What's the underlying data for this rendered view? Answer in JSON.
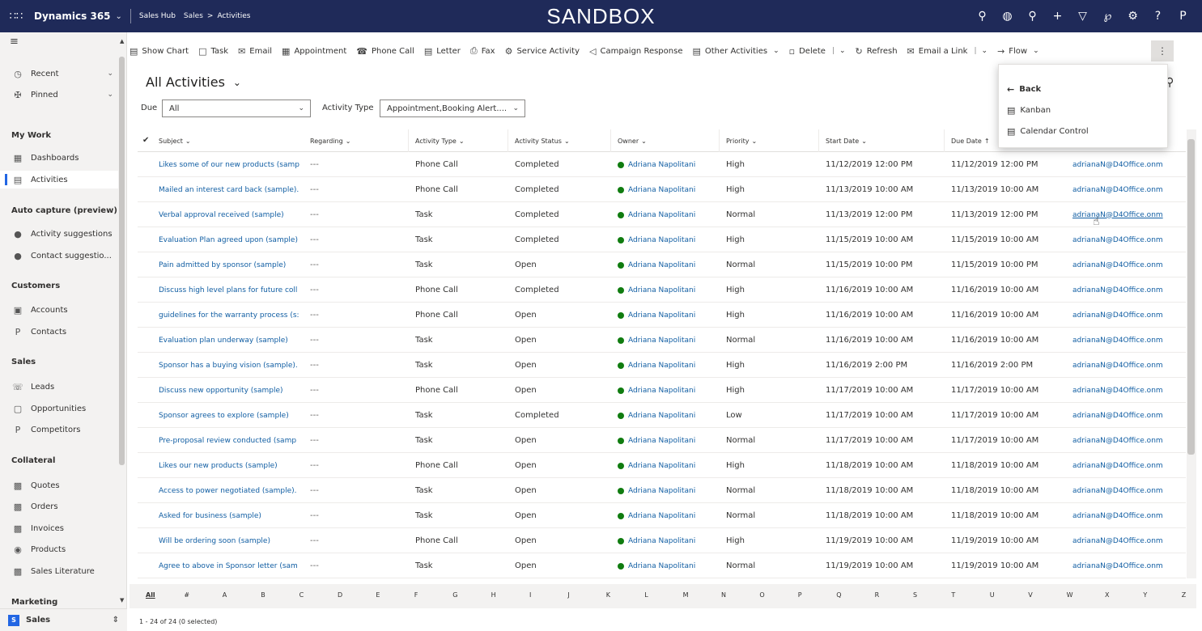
{
  "topbar": {
    "app_name": "Dynamics 365",
    "hub": "Sales Hub",
    "breadcrumb": [
      "Sales",
      "Activities"
    ],
    "environment": "SANDBOX",
    "icons": [
      "search-icon",
      "lightbulb-icon",
      "task-icon",
      "plus-icon",
      "filter-icon",
      "assistant-icon",
      "gear-icon",
      "help-icon",
      "user-icon"
    ]
  },
  "sidebar": {
    "recent": "Recent",
    "pinned": "Pinned",
    "sections": {
      "my_work": "My Work",
      "auto_capture": "Auto capture (preview)",
      "customers": "Customers",
      "sales": "Sales",
      "collateral": "Collateral",
      "marketing": "Marketing"
    },
    "items": {
      "dashboards": "Dashboards",
      "activities": "Activities",
      "activity_suggestions": "Activity suggestions",
      "contact_suggestions": "Contact suggestio...",
      "accounts": "Accounts",
      "contacts": "Contacts",
      "leads": "Leads",
      "opportunities": "Opportunities",
      "competitors": "Competitors",
      "quotes": "Quotes",
      "orders": "Orders",
      "invoices": "Invoices",
      "products": "Products",
      "sales_literature": "Sales Literature"
    },
    "area_badge": "S",
    "area": "Sales"
  },
  "commandbar": {
    "show_chart": "Show Chart",
    "task": "Task",
    "email": "Email",
    "appointment": "Appointment",
    "phone_call": "Phone Call",
    "letter": "Letter",
    "fax": "Fax",
    "service_activity": "Service Activity",
    "campaign_response": "Campaign Response",
    "other_activities": "Other Activities",
    "delete": "Delete",
    "refresh": "Refresh",
    "email_link": "Email a Link",
    "flow": "Flow"
  },
  "view": {
    "title": "All Activities",
    "due_label": "Due",
    "due_value": "All",
    "activity_type_label": "Activity Type",
    "activity_type_value": "Appointment,Booking Alert...."
  },
  "grid": {
    "headers": {
      "subject": "Subject",
      "regarding": "Regarding",
      "activity_type": "Activity Type",
      "activity_status": "Activity Status",
      "owner": "Owner",
      "priority": "Priority",
      "start_date": "Start Date",
      "due_date": "Due Date"
    },
    "rows": [
      {
        "subject": "Likes some of our new products (samp",
        "regarding": "---",
        "type": "Phone Call",
        "status": "Completed",
        "owner": "Adriana Napolitani",
        "priority": "High",
        "start": "11/12/2019 12:00 PM",
        "due": "11/12/2019 12:00 PM",
        "email": "adrianaN@D4Office.onm"
      },
      {
        "subject": "Mailed an interest card back (sample).",
        "regarding": "---",
        "type": "Phone Call",
        "status": "Completed",
        "owner": "Adriana Napolitani",
        "priority": "High",
        "start": "11/13/2019 10:00 AM",
        "due": "11/13/2019 10:00 AM",
        "email": "adrianaN@D4Office.onm"
      },
      {
        "subject": "Verbal approval received (sample)",
        "regarding": "---",
        "type": "Task",
        "status": "Completed",
        "owner": "Adriana Napolitani",
        "priority": "Normal",
        "start": "11/13/2019 12:00 PM",
        "due": "11/13/2019 12:00 PM",
        "email": "adrianaN@D4Office.onm"
      },
      {
        "subject": "Evaluation Plan agreed upon (sample)",
        "regarding": "---",
        "type": "Task",
        "status": "Completed",
        "owner": "Adriana Napolitani",
        "priority": "High",
        "start": "11/15/2019 10:00 AM",
        "due": "11/15/2019 10:00 AM",
        "email": "adrianaN@D4Office.onm"
      },
      {
        "subject": "Pain admitted by sponsor (sample)",
        "regarding": "---",
        "type": "Task",
        "status": "Open",
        "owner": "Adriana Napolitani",
        "priority": "Normal",
        "start": "11/15/2019 10:00 PM",
        "due": "11/15/2019 10:00 PM",
        "email": "adrianaN@D4Office.onm"
      },
      {
        "subject": "Discuss high level plans for future coll",
        "regarding": "---",
        "type": "Phone Call",
        "status": "Completed",
        "owner": "Adriana Napolitani",
        "priority": "High",
        "start": "11/16/2019 10:00 AM",
        "due": "11/16/2019 10:00 AM",
        "email": "adrianaN@D4Office.onm"
      },
      {
        "subject": "guidelines for the warranty process (s:",
        "regarding": "---",
        "type": "Phone Call",
        "status": "Open",
        "owner": "Adriana Napolitani",
        "priority": "High",
        "start": "11/16/2019 10:00 AM",
        "due": "11/16/2019 10:00 AM",
        "email": "adrianaN@D4Office.onm"
      },
      {
        "subject": "Evaluation plan underway (sample)",
        "regarding": "---",
        "type": "Task",
        "status": "Open",
        "owner": "Adriana Napolitani",
        "priority": "Normal",
        "start": "11/16/2019 10:00 AM",
        "due": "11/16/2019 10:00 AM",
        "email": "adrianaN@D4Office.onm"
      },
      {
        "subject": "Sponsor has a buying vision (sample).",
        "regarding": "---",
        "type": "Task",
        "status": "Open",
        "owner": "Adriana Napolitani",
        "priority": "High",
        "start": "11/16/2019 2:00 PM",
        "due": "11/16/2019 2:00 PM",
        "email": "adrianaN@D4Office.onm"
      },
      {
        "subject": "Discuss new opportunity (sample)",
        "regarding": "---",
        "type": "Phone Call",
        "status": "Open",
        "owner": "Adriana Napolitani",
        "priority": "High",
        "start": "11/17/2019 10:00 AM",
        "due": "11/17/2019 10:00 AM",
        "email": "adrianaN@D4Office.onm"
      },
      {
        "subject": "Sponsor agrees to explore (sample)",
        "regarding": "---",
        "type": "Task",
        "status": "Completed",
        "owner": "Adriana Napolitani",
        "priority": "Low",
        "start": "11/17/2019 10:00 AM",
        "due": "11/17/2019 10:00 AM",
        "email": "adrianaN@D4Office.onm"
      },
      {
        "subject": "Pre-proposal review conducted (samp",
        "regarding": "---",
        "type": "Task",
        "status": "Open",
        "owner": "Adriana Napolitani",
        "priority": "Normal",
        "start": "11/17/2019 10:00 AM",
        "due": "11/17/2019 10:00 AM",
        "email": "adrianaN@D4Office.onm"
      },
      {
        "subject": "Likes our new products (sample)",
        "regarding": "---",
        "type": "Phone Call",
        "status": "Open",
        "owner": "Adriana Napolitani",
        "priority": "High",
        "start": "11/18/2019 10:00 AM",
        "due": "11/18/2019 10:00 AM",
        "email": "adrianaN@D4Office.onm"
      },
      {
        "subject": "Access to power negotiated (sample).",
        "regarding": "---",
        "type": "Task",
        "status": "Open",
        "owner": "Adriana Napolitani",
        "priority": "Normal",
        "start": "11/18/2019 10:00 AM",
        "due": "11/18/2019 10:00 AM",
        "email": "adrianaN@D4Office.onm"
      },
      {
        "subject": "Asked for business (sample)",
        "regarding": "---",
        "type": "Task",
        "status": "Open",
        "owner": "Adriana Napolitani",
        "priority": "Normal",
        "start": "11/18/2019 10:00 AM",
        "due": "11/18/2019 10:00 AM",
        "email": "adrianaN@D4Office.onm"
      },
      {
        "subject": "Will be ordering soon (sample)",
        "regarding": "---",
        "type": "Phone Call",
        "status": "Open",
        "owner": "Adriana Napolitani",
        "priority": "High",
        "start": "11/19/2019 10:00 AM",
        "due": "11/19/2019 10:00 AM",
        "email": "adrianaN@D4Office.onm"
      },
      {
        "subject": "Agree to above in Sponsor letter (sam",
        "regarding": "---",
        "type": "Task",
        "status": "Open",
        "owner": "Adriana Napolitani",
        "priority": "Normal",
        "start": "11/19/2019 10:00 AM",
        "due": "11/19/2019 10:00 AM",
        "email": "adrianaN@D4Office.onm"
      }
    ]
  },
  "letters": [
    "All",
    "#",
    "A",
    "B",
    "C",
    "D",
    "E",
    "F",
    "G",
    "H",
    "I",
    "J",
    "K",
    "L",
    "M",
    "N",
    "O",
    "P",
    "Q",
    "R",
    "S",
    "T",
    "U",
    "V",
    "W",
    "X",
    "Y",
    "Z"
  ],
  "footer": "1 - 24 of 24 (0 selected)",
  "menu": {
    "back": "Back",
    "kanban": "Kanban",
    "calendar": "Calendar Control"
  }
}
